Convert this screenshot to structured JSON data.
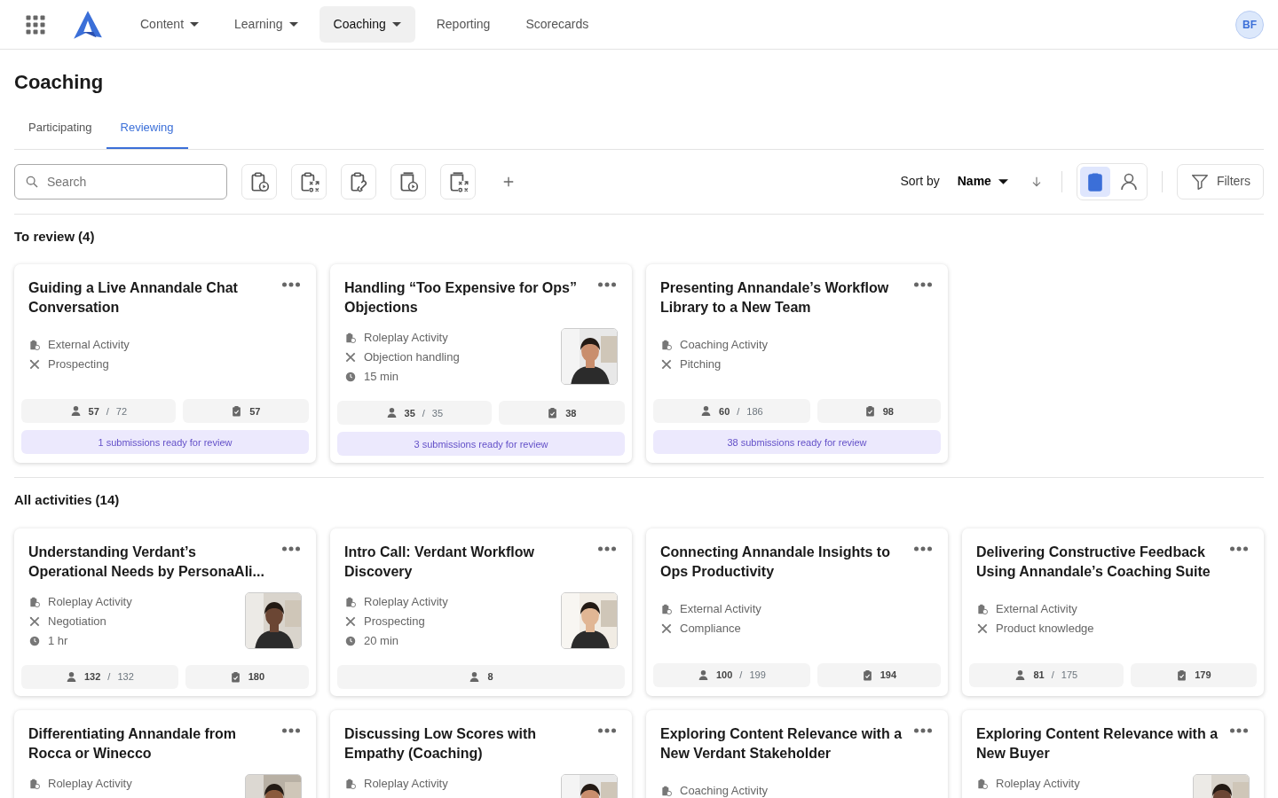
{
  "nav": {
    "items": [
      {
        "label": "Content",
        "dropdown": true,
        "selected": false
      },
      {
        "label": "Learning",
        "dropdown": true,
        "selected": false
      },
      {
        "label": "Coaching",
        "dropdown": true,
        "selected": true
      },
      {
        "label": "Reporting",
        "dropdown": false,
        "selected": false
      },
      {
        "label": "Scorecards",
        "dropdown": false,
        "selected": false
      }
    ],
    "avatar": "BF"
  },
  "page_title": "Coaching",
  "tabs": [
    {
      "label": "Participating",
      "selected": false
    },
    {
      "label": "Reviewing",
      "selected": true
    }
  ],
  "toolbar": {
    "search": {
      "placeholder": "Search"
    },
    "type_buttons": [
      {
        "kind": "clipboard-play"
      },
      {
        "kind": "clipboard-tactics"
      },
      {
        "kind": "clipboard-link"
      },
      {
        "kind": "book-play"
      },
      {
        "kind": "book-tactics"
      }
    ],
    "sort_label": "Sort by",
    "sort_value": "Name",
    "view_toggle": [
      {
        "kind": "clipboard",
        "selected": true
      },
      {
        "kind": "person",
        "selected": false
      }
    ],
    "filters": "Filters"
  },
  "sections": [
    {
      "title": "To review",
      "count": "(4)",
      "cards": [
        {
          "title": "Guiding a Live Annandale Chat Conversation",
          "picture": false,
          "meta": [
            {
              "kind": "type",
              "text": "External Activity"
            },
            {
              "kind": "skill",
              "text": "Prospecting"
            }
          ],
          "stats": [
            {
              "kind": "learners",
              "value": "57",
              "separator": "/",
              "total": "72"
            },
            {
              "kind": "submissions",
              "value": "57"
            }
          ],
          "review": "1 submissions ready for review"
        },
        {
          "title": "Handling “Too Expensive for Ops” Objections",
          "picture": true,
          "meta": [
            {
              "kind": "type",
              "text": "Roleplay Activity"
            },
            {
              "kind": "skill",
              "text": "Objection handling"
            },
            {
              "kind": "duration",
              "text": "15 min"
            }
          ],
          "stats": [
            {
              "kind": "learners",
              "value": "35",
              "separator": "/",
              "total": "35"
            },
            {
              "kind": "submissions",
              "value": "38"
            }
          ],
          "review": "3 submissions ready for review"
        },
        {
          "title": "Presenting Annandale’s Workflow Library to a New Team",
          "picture": false,
          "meta": [
            {
              "kind": "type",
              "text": "Coaching Activity"
            },
            {
              "kind": "skill",
              "text": "Pitching"
            }
          ],
          "stats": [
            {
              "kind": "learners",
              "value": "60",
              "separator": "/",
              "total": "186"
            },
            {
              "kind": "submissions",
              "value": "98"
            }
          ],
          "review": "38 submissions ready for review"
        }
      ]
    },
    {
      "title": "All activities",
      "count": "(14)",
      "cards": [
        {
          "title": "Understanding Verdant’s Operational Needs by PersonaAli...",
          "picture": true,
          "meta": [
            {
              "kind": "type",
              "text": "Roleplay Activity"
            },
            {
              "kind": "skill",
              "text": "Negotiation"
            },
            {
              "kind": "duration",
              "text": "1 hr"
            }
          ],
          "stats": [
            {
              "kind": "learners",
              "value": "132",
              "separator": "/",
              "total": "132"
            },
            {
              "kind": "submissions",
              "value": "180"
            }
          ]
        },
        {
          "title": "Intro Call: Verdant Workflow Discovery",
          "picture": true,
          "meta": [
            {
              "kind": "type",
              "text": "Roleplay Activity"
            },
            {
              "kind": "skill",
              "text": "Prospecting"
            },
            {
              "kind": "duration",
              "text": "20 min"
            }
          ],
          "stats": [
            {
              "kind": "learners",
              "value": "8"
            }
          ]
        },
        {
          "title": "Connecting Annandale Insights to Ops Productivity",
          "picture": false,
          "meta": [
            {
              "kind": "type",
              "text": "External Activity"
            },
            {
              "kind": "skill",
              "text": "Compliance"
            }
          ],
          "stats": [
            {
              "kind": "learners",
              "value": "100",
              "separator": "/",
              "total": "199"
            },
            {
              "kind": "submissions",
              "value": "194"
            }
          ]
        },
        {
          "title": "Delivering Constructive Feedback Using Annandale’s Coaching Suite",
          "picture": false,
          "meta": [
            {
              "kind": "type",
              "text": "External Activity"
            },
            {
              "kind": "skill",
              "text": "Product knowledge"
            }
          ],
          "stats": [
            {
              "kind": "learners",
              "value": "81",
              "separator": "/",
              "total": "175"
            },
            {
              "kind": "submissions",
              "value": "179"
            }
          ]
        },
        {
          "title": "Differentiating Annandale from Rocca or Winecco",
          "picture": true,
          "meta": [
            {
              "kind": "type",
              "text": "Roleplay Activity"
            }
          ]
        },
        {
          "title": "Discussing Low Scores with Empathy (Coaching)",
          "picture": true,
          "meta": [
            {
              "kind": "type",
              "text": "Roleplay Activity"
            }
          ]
        },
        {
          "title": "Exploring Content Relevance with a New Verdant Stakeholder",
          "picture": false,
          "meta": [
            {
              "kind": "type",
              "text": "Coaching Activity"
            }
          ]
        },
        {
          "title": "Exploring Content Relevance with a New Buyer",
          "picture": true,
          "meta": [
            {
              "kind": "type",
              "text": "Roleplay Activity"
            }
          ]
        }
      ]
    }
  ]
}
